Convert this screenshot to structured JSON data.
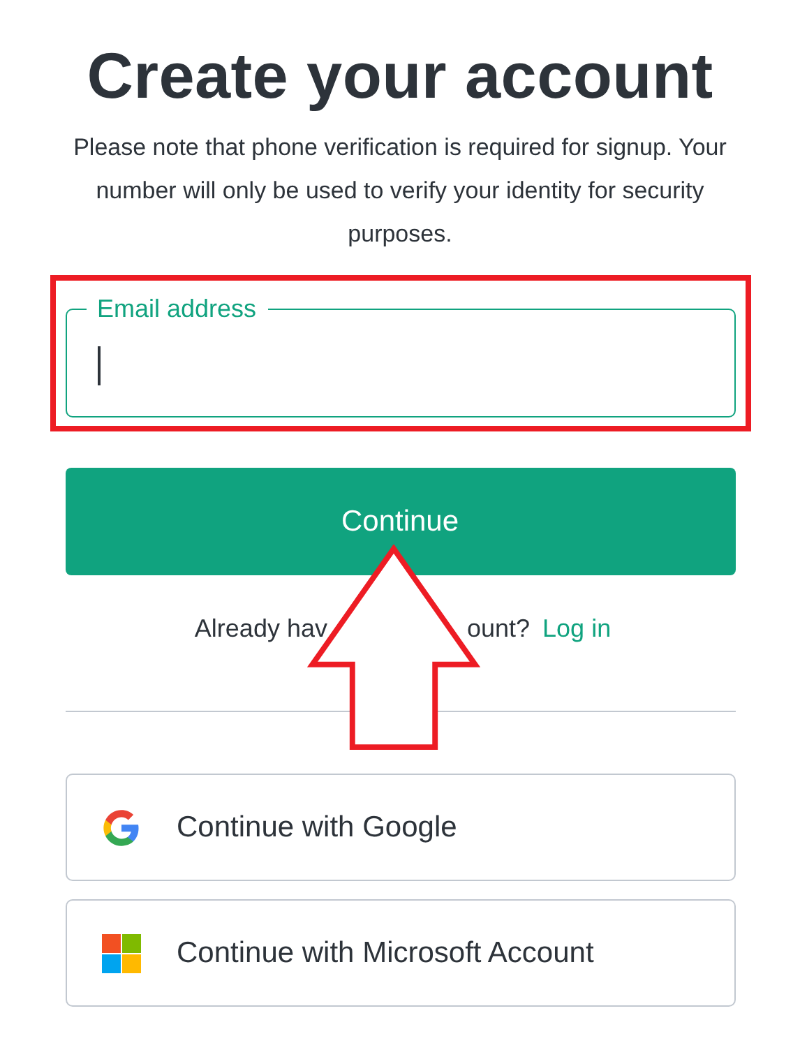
{
  "title": "Create your account",
  "notice": "Please note that phone verification is required for signup. Your number will only be used to verify your identity for security purposes.",
  "email_field": {
    "label": "Email address",
    "focused": true
  },
  "continue_button": "Continue",
  "login_prompt": {
    "text_parts": [
      "Already hav",
      "ount?"
    ],
    "link": "Log in"
  },
  "social_buttons": [
    {
      "kind": "google",
      "label": "Continue with Google"
    },
    {
      "kind": "microsoft",
      "label": "Continue with Microsoft Account"
    }
  ]
}
